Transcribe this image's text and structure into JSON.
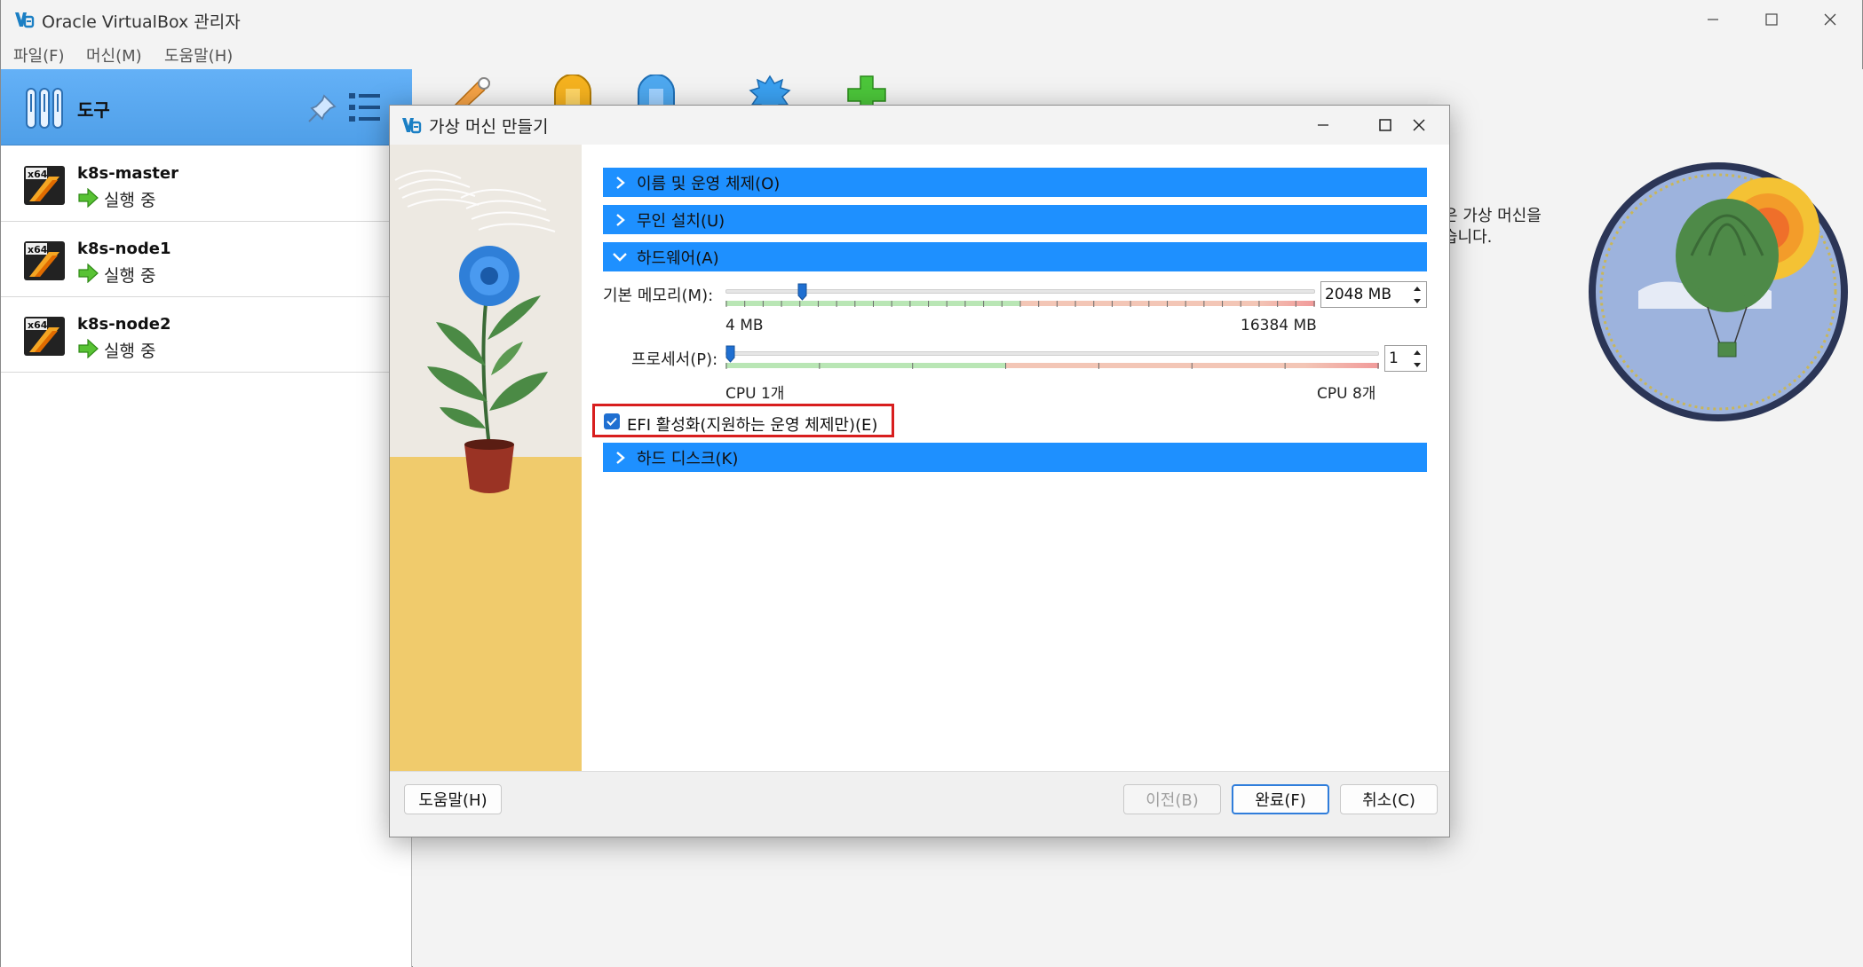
{
  "app": {
    "title": "Oracle VirtualBox 관리자"
  },
  "menu": {
    "file": "파일(F)",
    "machine": "머신(M)",
    "help": "도움말(H)"
  },
  "sidebar": {
    "tools_label": "도구",
    "vms": [
      {
        "name": "k8s-master",
        "state": "실행 중",
        "os_badge": "x64"
      },
      {
        "name": "k8s-node1",
        "state": "실행 중",
        "os_badge": "x64"
      },
      {
        "name": "k8s-node2",
        "state": "실행 중",
        "os_badge": "x64"
      }
    ]
  },
  "welcome": {
    "text": "은 가상 머신을\n습니다."
  },
  "dialog": {
    "title": "가상 머신 만들기",
    "sections": {
      "name_os": "이름 및 운영 체제(O)",
      "unattended": "무인 설치(U)",
      "hardware": "하드웨어(A)",
      "hard_disk": "하드 디스크(K)"
    },
    "memory": {
      "label": "기본 메모리(M):",
      "value": "2048 MB",
      "min_label": "4 MB",
      "max_label": "16384 MB",
      "min": 4,
      "max": 16384,
      "current": 2048,
      "recommended_fraction": 0.5
    },
    "processors": {
      "label": "프로세서(P):",
      "value": "1",
      "min_label": "CPU 1개",
      "max_label": "CPU 8개",
      "min": 1,
      "max": 8,
      "current": 1,
      "recommended_fraction": 0.43
    },
    "efi": {
      "label": "EFI 활성화(지원하는 운영 체제만)(E)",
      "checked": true
    },
    "buttons": {
      "help": "도움말(H)",
      "back": "이전(B)",
      "finish": "완료(F)",
      "cancel": "취소(C)"
    }
  },
  "colors": {
    "accent": "#1e90ff",
    "sidebar_selected": "#5aa8f3",
    "highlight_border": "#d81e1e",
    "slider_ok": "#b9e6b5",
    "slider_warn": "#f3c6b6",
    "slider_bad": "#f19a9a"
  }
}
